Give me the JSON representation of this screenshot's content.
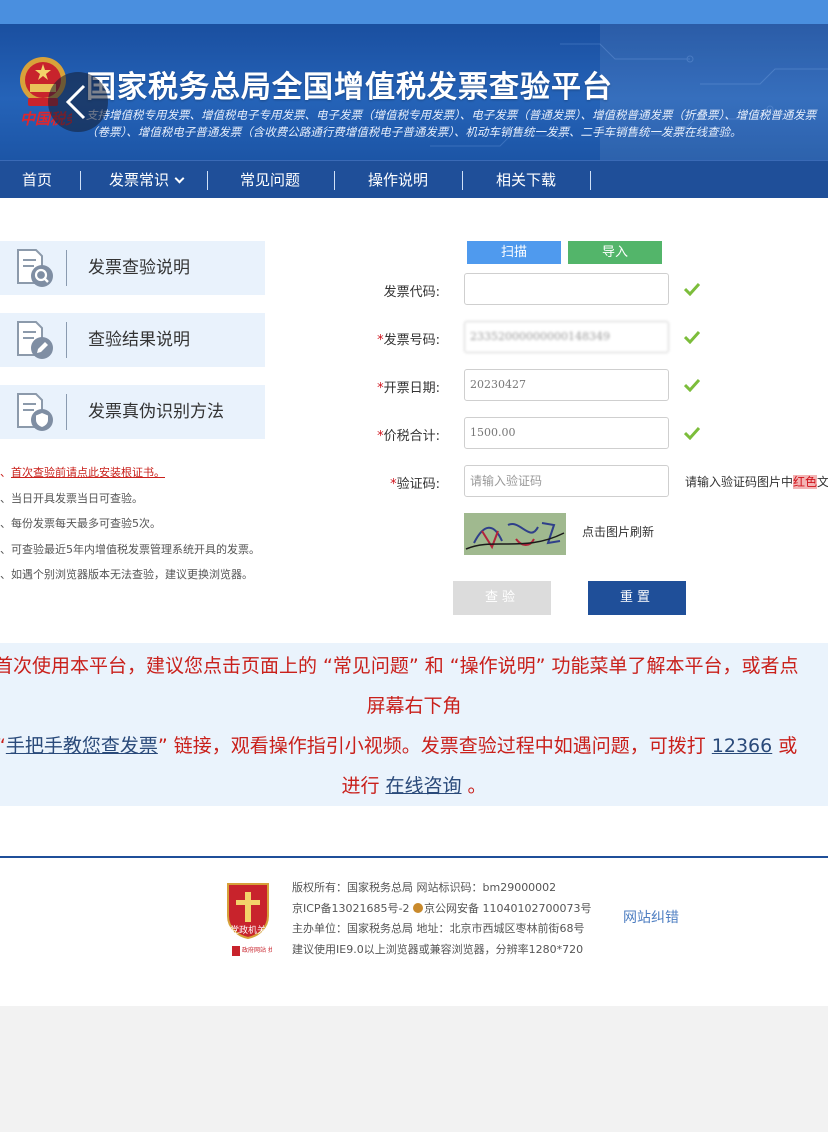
{
  "header": {
    "title": "国家税务总局全国增值税发票查验平台",
    "description": "支持增值税专用发票、增值税电子专用发票、电子发票（增值税专用发票）、电子发票（普通发票）、增值税普通发票（折叠票）、增值税普通发票（卷票）、增值税电子普通发票（含收费公路通行费增值税电子普通发票）、机动车销售统一发票、二手车销售统一发票在线查验。"
  },
  "nav": {
    "items": [
      "首页",
      "发票常识",
      "常见问题",
      "操作说明",
      "相关下载"
    ]
  },
  "sidebar": {
    "cards": [
      {
        "label": "发票查验说明",
        "icon": "document-search-icon"
      },
      {
        "label": "查验结果说明",
        "icon": "document-edit-icon"
      },
      {
        "label": "发票真伪识别方法",
        "icon": "document-shield-icon"
      }
    ],
    "notes": [
      {
        "text": "首次查验前请点此安装根证书。",
        "link": true
      },
      {
        "text": "当日开具发票当日可查验。",
        "link": false
      },
      {
        "text": "每份发票每天最多可查验5次。",
        "link": false
      },
      {
        "text": "可查验最近5年内增值税发票管理系统开具的发票。",
        "link": false
      },
      {
        "text": "如遇个别浏览器版本无法查验，建议更换浏览器。",
        "link": false
      }
    ],
    "bullet": "、"
  },
  "form": {
    "tab_scan": "扫描",
    "tab_import": "导入",
    "required_mark": "*",
    "invoice_code": {
      "label": "发票代码:",
      "value": ""
    },
    "invoice_number": {
      "label": "发票号码:",
      "value": "23352000000000148349"
    },
    "issue_date": {
      "label": "开票日期:",
      "value": "20230427"
    },
    "total_amount": {
      "label": "价税合计:",
      "value": "1500.00"
    },
    "captcha": {
      "label": "验证码:",
      "placeholder": "请输入验证码"
    },
    "captcha_hint_prefix": "请输入验证码图片中",
    "captcha_hint_color": "红色",
    "captcha_hint_suffix": "文",
    "refresh_label": "点击图片刷新",
    "check_button": "查验",
    "reset_button": "重置"
  },
  "notice": {
    "line1": "首次使用本平台，建议您点击页面上的 “常见问题” 和 “操作说明” 功能菜单了解本平台，或者点",
    "line2": "屏幕右下角",
    "line3_open": "“",
    "line3_link": "手把手教您查发票",
    "line3_text": "” 链接，观看操作指引小视频。发票查验过程中如遇问题，可拨打 ",
    "line3_phone": "12366",
    "line3_end": " 或",
    "line4_prefix": "进行 ",
    "line4_link": "在线咨询",
    "line4_suffix": " 。"
  },
  "footer": {
    "line1": "版权所有：国家税务总局 网站标识码：bm29000002",
    "line2a": "京ICP备13021685号-2 ",
    "line2b": "京公网安备 11040102700073号",
    "line3": "主办单位：国家税务总局 地址：北京市西城区枣林前街68号",
    "line4": "建议使用IE9.0以上浏览器或兼容浏览器，分辨率1280*720",
    "error_link": "网站纠错",
    "badge_text": "党政机关",
    "badge_sub": "政府网站 找错"
  },
  "colors": {
    "brand_blue": "#1f4f99",
    "required_red": "#d0121b",
    "scan_blue": "#4f9aee",
    "import_green": "#53b56a",
    "check_green": "#7cbd3b"
  }
}
